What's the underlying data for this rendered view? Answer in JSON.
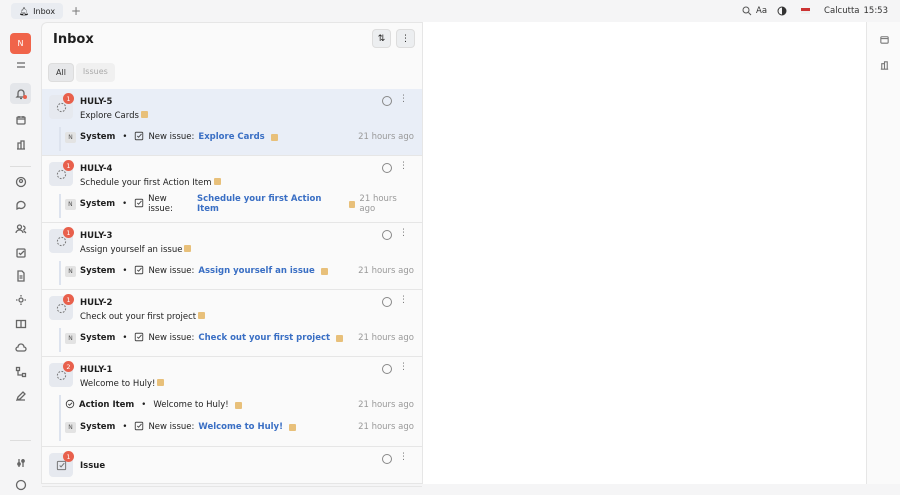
{
  "topbar": {
    "tab_label": "Inbox",
    "add_tab": "+",
    "font_label": "Aa",
    "location": "Calcutta",
    "time": "15:53"
  },
  "workspace_initial": "N",
  "inbox": {
    "title": "Inbox",
    "filter_tabs": [
      "All",
      "Issues"
    ]
  },
  "rows": [
    {
      "id": "HULY-5",
      "title": "Explore Cards",
      "badge": "1",
      "subs": [
        {
          "kind": "system",
          "who": "System",
          "text": "New issue:",
          "link": "Explore Cards",
          "time": "21 hours ago"
        }
      ]
    },
    {
      "id": "HULY-4",
      "title": "Schedule your first Action Item",
      "badge": "1",
      "subs": [
        {
          "kind": "system",
          "who": "System",
          "text": "New issue:",
          "link": "Schedule your first Action Item",
          "time": "21 hours ago"
        }
      ]
    },
    {
      "id": "HULY-3",
      "title": "Assign yourself an issue",
      "badge": "1",
      "subs": [
        {
          "kind": "system",
          "who": "System",
          "text": "New issue:",
          "link": "Assign yourself an issue",
          "time": "21 hours ago"
        }
      ]
    },
    {
      "id": "HULY-2",
      "title": "Check out your first project",
      "badge": "1",
      "subs": [
        {
          "kind": "system",
          "who": "System",
          "text": "New issue:",
          "link": "Check out your first project",
          "time": "21 hours ago"
        }
      ]
    },
    {
      "id": "HULY-1",
      "title": "Welcome to Huly!",
      "badge": "2",
      "subs": [
        {
          "kind": "action",
          "who": "Action Item",
          "text": "Welcome to Huly!",
          "link": "",
          "time": "21 hours ago"
        },
        {
          "kind": "system",
          "who": "System",
          "text": "New issue:",
          "link": "Welcome to Huly!",
          "time": "21 hours ago"
        }
      ]
    },
    {
      "id": "Issue",
      "title": "",
      "badge": "1",
      "subs": []
    }
  ]
}
